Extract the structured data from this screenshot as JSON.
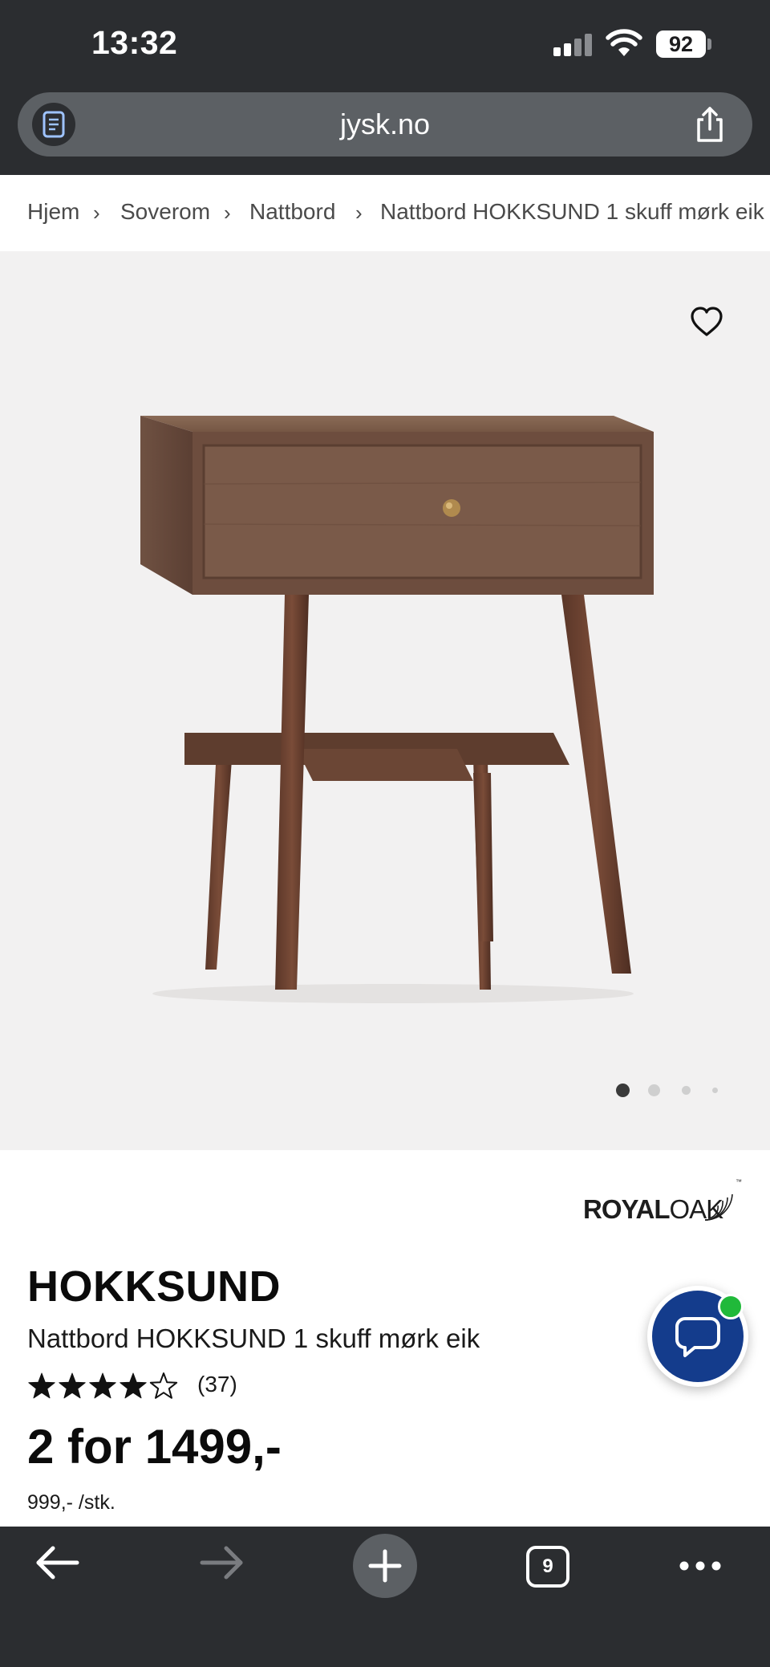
{
  "status_bar": {
    "time": "13:32",
    "battery": "92"
  },
  "browser": {
    "url": "jysk.no",
    "tab_count": "9"
  },
  "breadcrumb": {
    "items": [
      "Hjem",
      "Soverom",
      "Nattbord",
      "Nattbord HOKKSUND 1 skuff mørk eik"
    ],
    "separator": "›"
  },
  "gallery": {
    "image_count": 4,
    "active_index": 0
  },
  "product": {
    "brand_bold": "ROYAL",
    "brand_light": "OAK",
    "brand_tm": "™",
    "name": "HOKKSUND",
    "subtitle": "Nattbord HOKKSUND 1 skuff mørk eik",
    "rating": 4,
    "rating_max": 5,
    "review_count": "(37)",
    "price": "2 for 1499,-",
    "unit_price": "999,- /stk."
  },
  "colors": {
    "chrome_bg": "#2b2d30",
    "gallery_bg": "#f2f1f1",
    "chat_blue": "#143c8c",
    "online_green": "#20b93a"
  },
  "icons": {
    "reader": "reader-mode-icon",
    "share": "share-icon",
    "favorite": "heart-icon",
    "chat": "chat-bubble-icon",
    "back": "arrow-left-icon",
    "forward": "arrow-right-icon",
    "new_tab": "plus-icon"
  }
}
